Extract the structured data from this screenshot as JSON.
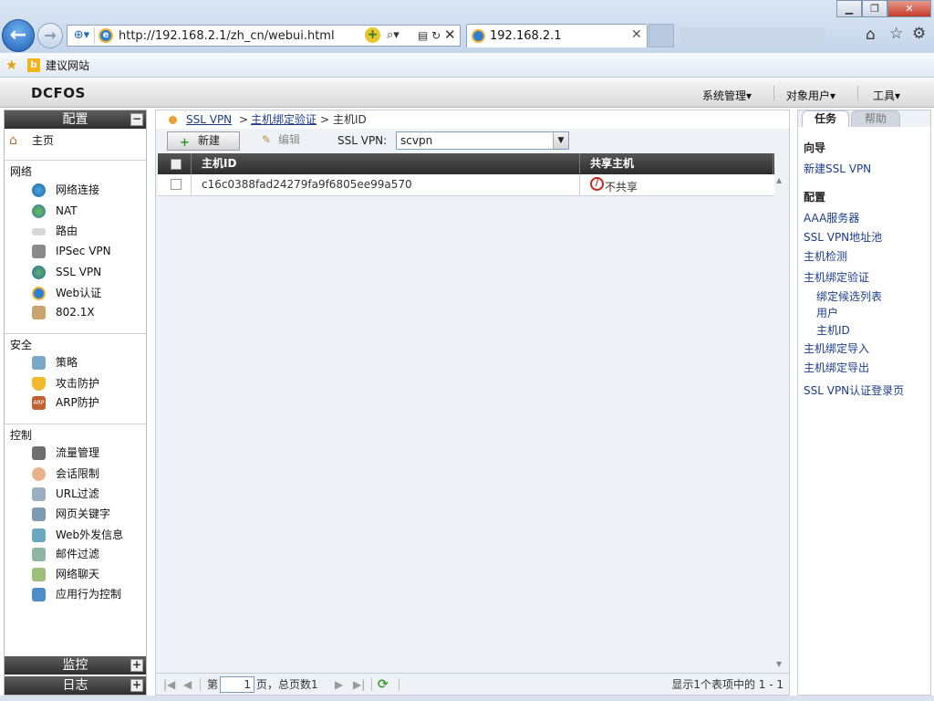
{
  "browser": {
    "url": "http://192.168.2.1/zh_cn/webui.html",
    "tab_title": "192.168.2.1",
    "favorites_item": "建议网站"
  },
  "app": {
    "logo": "DCFOS",
    "menus": [
      "系统管理▾",
      "对象用户▾",
      "工具▾"
    ]
  },
  "left": {
    "config_title": "配置",
    "home": "主页",
    "groups": {
      "network": "网络",
      "security": "安全",
      "control": "控制"
    },
    "network_items": [
      "网络连接",
      "NAT",
      "路由",
      "IPSec VPN",
      "SSL VPN",
      "Web认证",
      "802.1X"
    ],
    "security_items": [
      "策略",
      "攻击防护",
      "ARP防护"
    ],
    "control_items": [
      "流量管理",
      "会话限制",
      "URL过滤",
      "网页关键字",
      "Web外发信息",
      "邮件过滤",
      "网络聊天",
      "应用行为控制"
    ],
    "monitor_title": "监控",
    "log_title": "日志"
  },
  "breadcrumb": {
    "level1": "SSL VPN",
    "sep": ">",
    "level2": "主机绑定验证",
    "level3": "主机ID"
  },
  "toolbar": {
    "new_label": "新建",
    "edit_label": "编辑",
    "vpn_label": "SSL VPN:",
    "vpn_value": "scvpn"
  },
  "grid": {
    "columns": [
      "主机ID",
      "共享主机"
    ],
    "rows": [
      {
        "host_id": "c16c0388fad24279fa9f6805ee99a570",
        "shared": "不共享"
      }
    ]
  },
  "pager": {
    "pre": "第",
    "page": "1",
    "post": "页，总页数1",
    "info": "显示1个表项中的 1 - 1"
  },
  "right": {
    "tab_task": "任务",
    "tab_help": "帮助",
    "wizard_title": "向导",
    "wizard_link": "新建SSL VPN",
    "config_title": "配置",
    "links": [
      "AAA服务器",
      "SSL VPN地址池",
      "主机检测",
      "主机绑定验证"
    ],
    "sublinks": [
      "绑定候选列表",
      "用户",
      "主机ID"
    ],
    "links2": [
      "主机绑定导入",
      "主机绑定导出",
      "SSL VPN认证登录页"
    ]
  },
  "colors": {
    "accent_link": "#1b3c8c",
    "header_dark": "#2f2f2f",
    "deny_red": "#d0221c"
  }
}
